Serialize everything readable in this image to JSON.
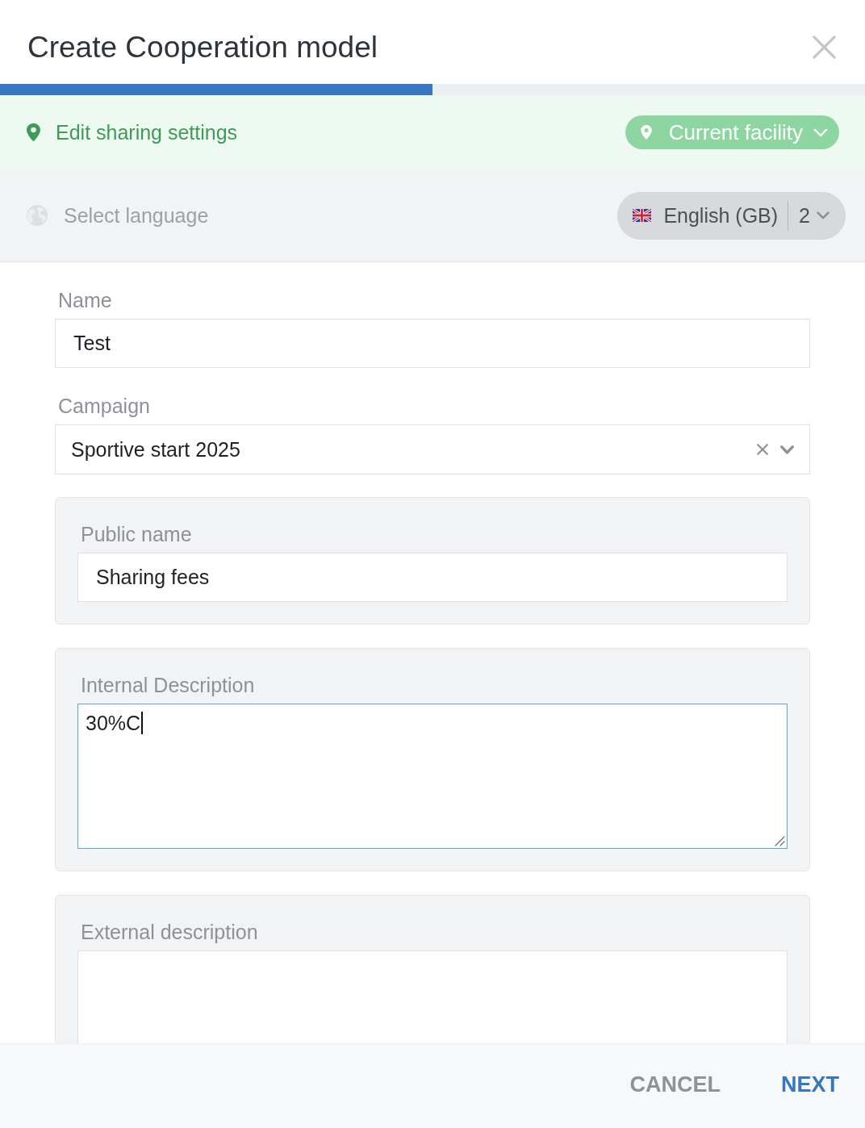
{
  "dialog": {
    "title": "Create Cooperation model",
    "progress": {
      "level": 0.5
    }
  },
  "sharing_bar": {
    "label": "Edit sharing settings",
    "dropdown": {
      "value": "Current facility"
    }
  },
  "language_bar": {
    "label": "Select language",
    "dropdown": {
      "value": "English (GB)",
      "count": "2"
    }
  },
  "fields": [
    {
      "kind": "text",
      "label": "Name",
      "value": "Test",
      "focused": false
    },
    {
      "kind": "select",
      "label": "Campaign",
      "value": "Sportive start 2025",
      "focused": false
    },
    {
      "kind": "boxed-text",
      "label": "Public name",
      "value": "Sharing fees",
      "focused": false
    },
    {
      "kind": "boxed-textarea",
      "label": "Internal Description",
      "value": "30%C",
      "focused": true
    },
    {
      "kind": "boxed-textarea",
      "label": "External description",
      "focused": false
    }
  ],
  "footer": {
    "buttons": [
      {
        "kind": "secondary",
        "label": "CANCEL"
      },
      {
        "kind": "primary",
        "label": "NEXT"
      }
    ]
  }
}
